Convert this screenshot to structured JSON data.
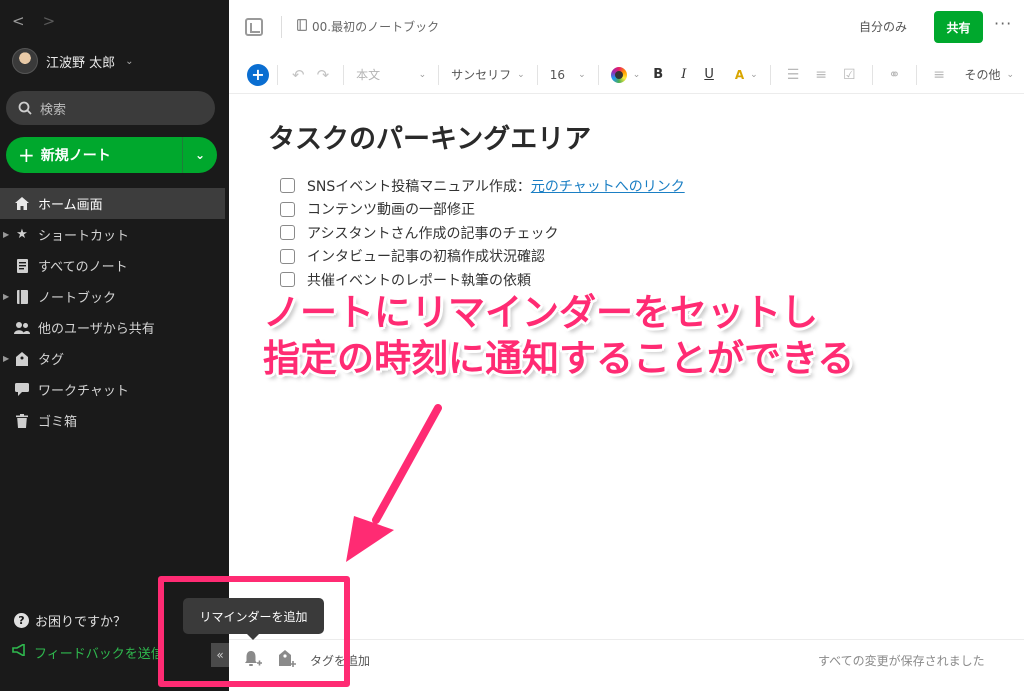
{
  "sidebar": {
    "nav_back": "<",
    "nav_forward": ">",
    "user_name": "江波野 太郎",
    "search_placeholder": "検索",
    "new_note_label": "新規ノート",
    "items": [
      {
        "label": "ホーム画面",
        "icon": "home-icon",
        "active": true
      },
      {
        "label": "ショートカット",
        "icon": "star-icon"
      },
      {
        "label": "すべてのノート",
        "icon": "note-icon"
      },
      {
        "label": "ノートブック",
        "icon": "notebook-icon"
      },
      {
        "label": "他のユーザから共有",
        "icon": "people-icon"
      },
      {
        "label": "タグ",
        "icon": "tag-icon"
      },
      {
        "label": "ワークチャット",
        "icon": "chat-icon"
      },
      {
        "label": "ゴミ箱",
        "icon": "trash-icon"
      }
    ],
    "help_label": "お困りですか？",
    "feedback_label": "フィードバックを送信",
    "collapse_label": "«"
  },
  "header": {
    "notebook_name": "00.最初のノートブック",
    "visibility": "自分のみ",
    "share_label": "共有",
    "more_label": "···"
  },
  "toolbar": {
    "style": "本文",
    "font": "サンセリフ",
    "size": "16",
    "bold": "B",
    "italic": "I",
    "underline": "U",
    "highlight": "A",
    "more_label": "その他"
  },
  "note": {
    "title": "タスクのパーキングエリア",
    "tasks": [
      {
        "text": "SNSイベント投稿マニュアル作成：",
        "link": "元のチャットへのリンク"
      },
      {
        "text": "コンテンツ動画の一部修正"
      },
      {
        "text": "アシスタントさん作成の記事のチェック"
      },
      {
        "text": "インタビュー記事の初稿作成状況確認"
      },
      {
        "text": "共催イベントのレポート執筆の依頼"
      }
    ]
  },
  "annotation": {
    "line1": "ノートにリマインダーをセットし",
    "line2": "指定の時刻に通知することができる"
  },
  "footer": {
    "tooltip": "リマインダーを追加",
    "add_tag": "タグを追加",
    "saved_status": "すべての変更が保存されました"
  },
  "colors": {
    "accent_green": "#00a82d",
    "annotation_pink": "#ff2b73",
    "sidebar_bg": "#1a1a1a",
    "link_blue": "#1b7fc4"
  }
}
